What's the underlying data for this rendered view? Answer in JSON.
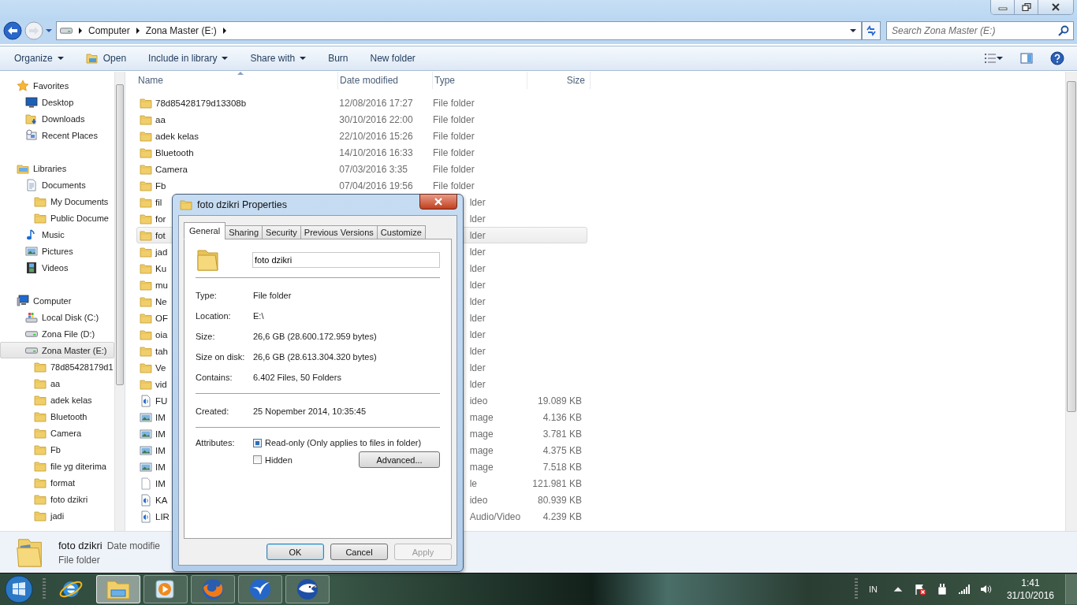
{
  "address_bar": {
    "crumbs": [
      "Computer",
      "Zona Master (E:)"
    ]
  },
  "search": {
    "placeholder": "Search Zona Master (E:)"
  },
  "toolbar": {
    "items": [
      {
        "label": "Organize",
        "kind": "menu"
      },
      {
        "label": "Open",
        "kind": "open"
      },
      {
        "label": "Include in library",
        "kind": "menu"
      },
      {
        "label": "Share with",
        "kind": "menu"
      },
      {
        "label": "Burn",
        "kind": "plain"
      },
      {
        "label": "New folder",
        "kind": "plain"
      }
    ]
  },
  "nav_pane": {
    "items": [
      {
        "label": "Favorites",
        "kind": "favorites",
        "selected": false,
        "children": [
          {
            "label": "Desktop",
            "kind": "desktop",
            "selected": false
          },
          {
            "label": "Downloads",
            "kind": "downloads",
            "selected": false
          },
          {
            "label": "Recent Places",
            "kind": "recent",
            "selected": false
          }
        ]
      },
      {
        "label": "Libraries",
        "kind": "libraries",
        "selected": false,
        "children": [
          {
            "label": "Documents",
            "kind": "documents",
            "selected": false,
            "children": [
              {
                "label": "My Documents",
                "kind": "folder",
                "selected": false
              },
              {
                "label": "Public Docume",
                "kind": "folder",
                "selected": false
              }
            ]
          },
          {
            "label": "Music",
            "kind": "music",
            "selected": false
          },
          {
            "label": "Pictures",
            "kind": "pictures",
            "selected": false
          },
          {
            "label": "Videos",
            "kind": "videos",
            "selected": false
          }
        ]
      },
      {
        "label": "Computer",
        "kind": "computer",
        "selected": false,
        "children": [
          {
            "label": "Local Disk (C:)",
            "kind": "system-disk",
            "selected": false
          },
          {
            "label": "Zona File (D:)",
            "kind": "drive",
            "selected": false
          },
          {
            "label": "Zona Master (E:)",
            "kind": "drive",
            "selected": true,
            "children": [
              {
                "label": "78d85428179d1",
                "kind": "folder",
                "selected": false
              },
              {
                "label": "aa",
                "kind": "folder",
                "selected": false
              },
              {
                "label": "adek kelas",
                "kind": "folder",
                "selected": false
              },
              {
                "label": "Bluetooth",
                "kind": "folder",
                "selected": false
              },
              {
                "label": "Camera",
                "kind": "folder",
                "selected": false
              },
              {
                "label": "Fb",
                "kind": "folder",
                "selected": false
              },
              {
                "label": "file yg diterima",
                "kind": "folder",
                "selected": false
              },
              {
                "label": "format",
                "kind": "folder",
                "selected": false
              },
              {
                "label": "foto dzikri",
                "kind": "folder",
                "selected": false
              },
              {
                "label": "jadi",
                "kind": "folder",
                "selected": false
              }
            ]
          }
        ]
      }
    ]
  },
  "columns": [
    {
      "label": "Name",
      "sorted": true
    },
    {
      "label": "Date modified",
      "sorted": false
    },
    {
      "label": "Type",
      "sorted": false
    },
    {
      "label": "Size",
      "sorted": false
    }
  ],
  "rows": [
    {
      "name": "78d85428179d13308b",
      "date": "12/08/2016 17:27",
      "type": "File folder",
      "kind": "folder",
      "selected": false
    },
    {
      "name": "aa",
      "date": "30/10/2016 22:00",
      "type": "File folder",
      "kind": "folder",
      "selected": false
    },
    {
      "name": "adek kelas",
      "date": "22/10/2016 15:26",
      "type": "File folder",
      "kind": "folder",
      "selected": false
    },
    {
      "name": "Bluetooth",
      "date": "14/10/2016 16:33",
      "type": "File folder",
      "kind": "folder",
      "selected": false
    },
    {
      "name": "Camera",
      "date": "07/03/2016 3:35",
      "type": "File folder",
      "kind": "folder",
      "selected": false
    },
    {
      "name": "Fb",
      "date": "07/04/2016 19:56",
      "type": "File folder",
      "kind": "folder",
      "selected": false
    },
    {
      "name": "fil",
      "type": "lder",
      "kind": "folder",
      "selected": false
    },
    {
      "name": "for",
      "type": "lder",
      "kind": "folder",
      "selected": false
    },
    {
      "name": "fot",
      "type": "lder",
      "kind": "folder",
      "selected": true
    },
    {
      "name": "jad",
      "type": "lder",
      "kind": "folder",
      "selected": false
    },
    {
      "name": "Ku",
      "type": "lder",
      "kind": "folder",
      "selected": false
    },
    {
      "name": "mu",
      "type": "lder",
      "kind": "folder",
      "selected": false
    },
    {
      "name": "Ne",
      "type": "lder",
      "kind": "folder",
      "selected": false
    },
    {
      "name": "OF",
      "type": "lder",
      "kind": "folder",
      "selected": false
    },
    {
      "name": "oia",
      "type": "lder",
      "kind": "folder",
      "selected": false
    },
    {
      "name": "tah",
      "type": "lder",
      "kind": "folder",
      "selected": false
    },
    {
      "name": "Ve",
      "type": "lder",
      "kind": "folder",
      "selected": false
    },
    {
      "name": "vid",
      "type": "lder",
      "kind": "folder",
      "selected": false
    },
    {
      "name": "FU",
      "type": "ideo",
      "size": "19.089 KB",
      "kind": "media",
      "selected": false
    },
    {
      "name": "IM",
      "type": "mage",
      "size": "4.136 KB",
      "kind": "image",
      "selected": false
    },
    {
      "name": "IM",
      "type": "mage",
      "size": "3.781 KB",
      "kind": "image",
      "selected": false
    },
    {
      "name": "IM",
      "type": "mage",
      "size": "4.375 KB",
      "kind": "image",
      "selected": false
    },
    {
      "name": "IM",
      "type": "mage",
      "size": "7.518 KB",
      "kind": "image",
      "selected": false
    },
    {
      "name": "IM",
      "type": "le",
      "size": "121.981 KB",
      "kind": "file",
      "selected": false
    },
    {
      "name": "KA",
      "type": "ideo",
      "size": "80.939 KB",
      "kind": "media",
      "selected": false
    },
    {
      "name": "LIR",
      "type": "Audio/Video",
      "size": "4.239 KB",
      "kind": "media",
      "selected": false
    }
  ],
  "details": {
    "name": "foto dzikri",
    "meta": "Date modifie",
    "type": "File folder"
  },
  "dialog": {
    "title": "foto dzikri Properties",
    "tabs": [
      {
        "label": "General",
        "selected": true
      },
      {
        "label": "Sharing",
        "selected": false
      },
      {
        "label": "Security",
        "selected": false
      },
      {
        "label": "Previous Versions",
        "selected": false
      },
      {
        "label": "Customize",
        "selected": false
      }
    ],
    "name_value": "foto dzikri",
    "sections": [
      [
        {
          "label": "Type:",
          "value": "File folder"
        },
        {
          "label": "Location:",
          "value": "E:\\"
        },
        {
          "label": "Size:",
          "value": "26,6 GB (28.600.172.959 bytes)"
        },
        {
          "label": "Size on disk:",
          "value": "26,6 GB (28.613.304.320 bytes)"
        },
        {
          "label": "Contains:",
          "value": "6.402 Files, 50 Folders"
        }
      ],
      [
        {
          "label": "Created:",
          "value": "25 Nopember 2014, 10:35:45"
        }
      ]
    ],
    "attributes": {
      "label": "Attributes:",
      "options": [
        {
          "label": "Read-only (Only applies to files in folder)",
          "checked": true
        },
        {
          "label": "Hidden",
          "checked": false
        }
      ],
      "advanced_button": "Advanced..."
    },
    "buttons": [
      {
        "label": "OK",
        "default": true,
        "disabled": false
      },
      {
        "label": "Cancel",
        "default": false,
        "disabled": false
      },
      {
        "label": "Apply",
        "default": false,
        "disabled": true
      }
    ]
  },
  "taskbar": {
    "apps": [
      {
        "kind": "ie",
        "running": false,
        "selected": false
      },
      {
        "kind": "explorer",
        "running": true,
        "selected": true
      },
      {
        "kind": "media-player",
        "running": true,
        "selected": false
      },
      {
        "kind": "firefox",
        "running": true,
        "selected": false
      },
      {
        "kind": "bird",
        "running": true,
        "selected": false
      },
      {
        "kind": "eagle",
        "running": true,
        "selected": false
      }
    ],
    "tray": {
      "language": "IN",
      "time": "1:41",
      "date": "31/10/2016"
    }
  }
}
